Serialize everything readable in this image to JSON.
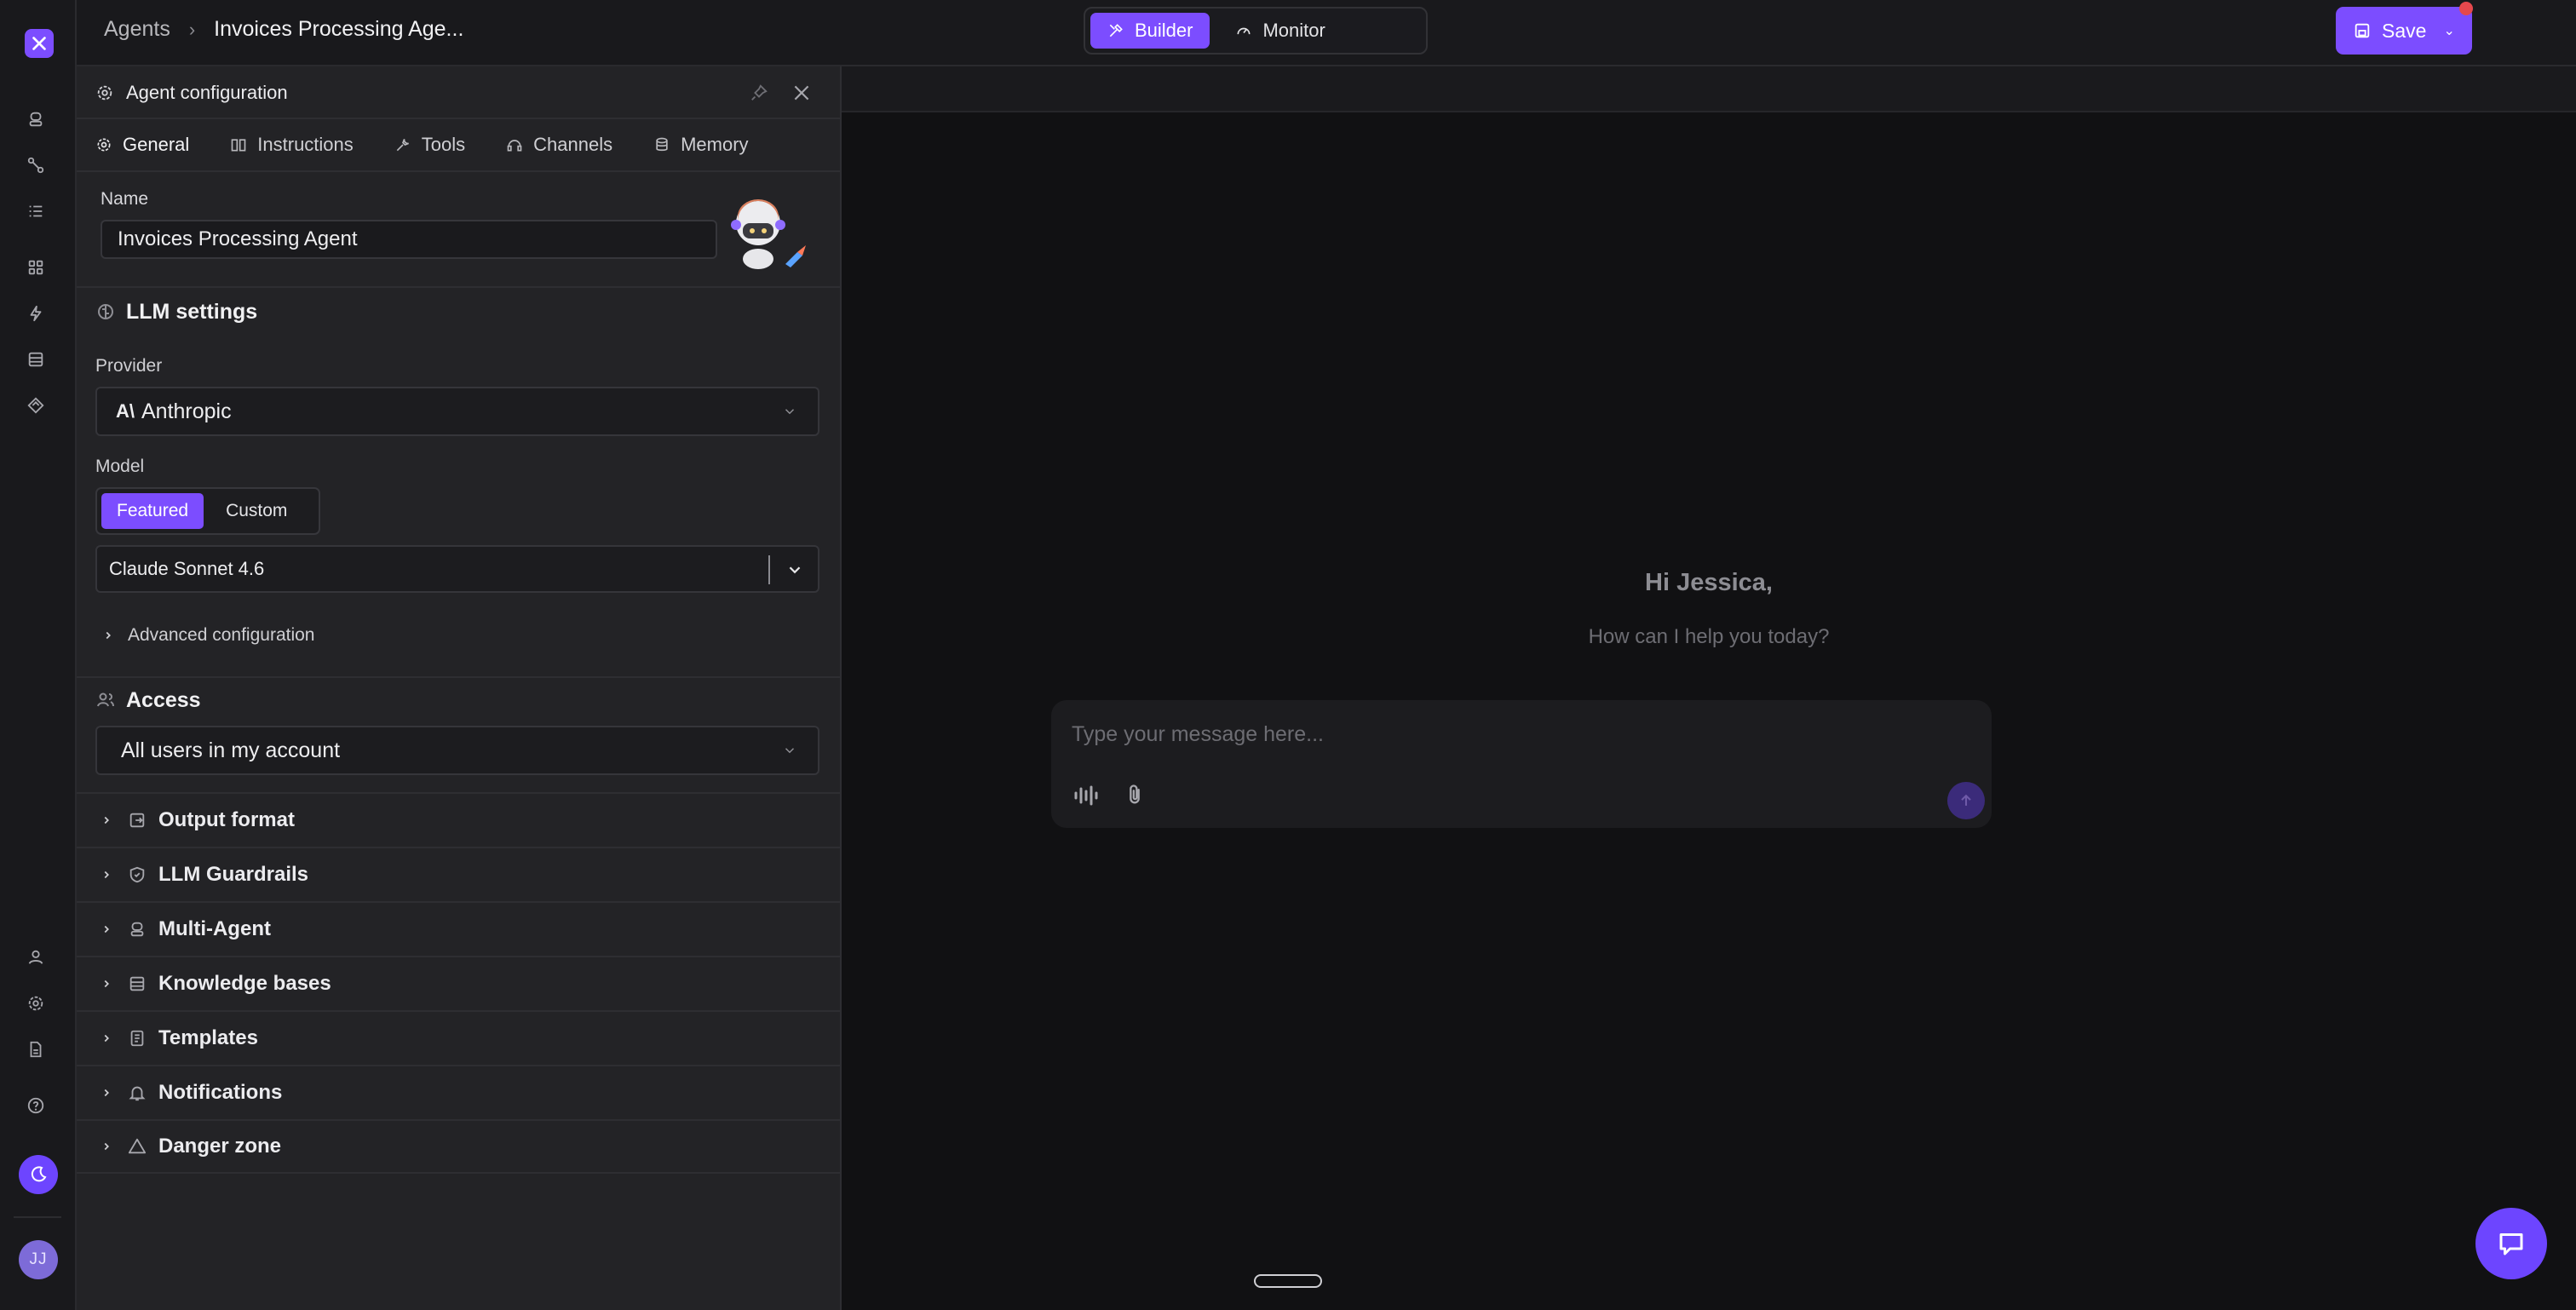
{
  "breadcrumb": {
    "root": "Agents",
    "current": "Invoices Processing Age..."
  },
  "mode_tabs": [
    {
      "label": "Builder",
      "active": true
    },
    {
      "label": "Monitor",
      "active": false
    }
  ],
  "save_label": "Save",
  "panel": {
    "title": "Agent configuration",
    "tabs": [
      "General",
      "Instructions",
      "Tools",
      "Channels",
      "Memory"
    ],
    "name_label": "Name",
    "name_value": "Invoices Processing Agent",
    "llm_title": "LLM settings",
    "provider_label": "Provider",
    "provider_value": "Anthropic",
    "model_label": "Model",
    "model_toggle": [
      "Featured",
      "Custom"
    ],
    "model_value": "Claude Sonnet 4.6",
    "advanced_label": "Advanced configuration",
    "access_title": "Access",
    "access_value": "All users in my account",
    "sections": [
      "Output format",
      "LLM Guardrails",
      "Multi-Agent",
      "Knowledge bases",
      "Templates",
      "Notifications",
      "Danger zone"
    ]
  },
  "chat": {
    "greeting": "Hi Jessica,",
    "subtitle": "How can I help you today?",
    "placeholder": "Type your message here..."
  },
  "user_initials": "JJ",
  "colors": {
    "accent": "#7c4dff",
    "background": "#111113",
    "panel": "#232326"
  }
}
